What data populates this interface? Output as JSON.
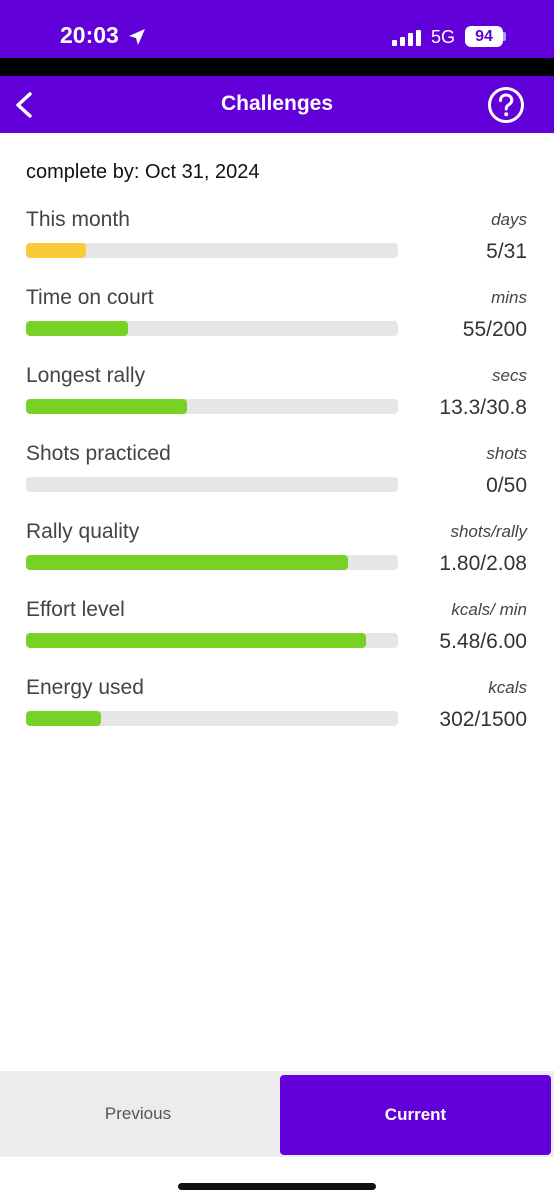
{
  "status_bar": {
    "time": "20:03",
    "network": "5G",
    "battery": "94",
    "icons": [
      "location-arrow-icon",
      "cellular-signal-icon",
      "battery-icon"
    ]
  },
  "header": {
    "title": "Challenges",
    "back_icon": "chevron-left-icon",
    "help_icon": "question-circle-icon"
  },
  "complete_by": "complete by: Oct 31, 2024",
  "challenges": [
    {
      "label": "This month",
      "unit": "days",
      "value": "5/31",
      "progress": 0.161,
      "color": "#fcc93a"
    },
    {
      "label": "Time on court",
      "unit": "mins",
      "value": "55/200",
      "progress": 0.275,
      "color": "#78d226"
    },
    {
      "label": "Longest rally",
      "unit": "secs",
      "value": "13.3/30.8",
      "progress": 0.432,
      "color": "#78d226"
    },
    {
      "label": "Shots practiced",
      "unit": "shots",
      "value": "0/50",
      "progress": 0.0,
      "color": "#78d226"
    },
    {
      "label": "Rally quality",
      "unit": "shots/rally",
      "value": "1.80/2.08",
      "progress": 0.865,
      "color": "#78d226"
    },
    {
      "label": "Effort level",
      "unit": "kcals/ min",
      "value": "5.48/6.00",
      "progress": 0.913,
      "color": "#78d226"
    },
    {
      "label": "Energy used",
      "unit": "kcals",
      "value": "302/1500",
      "progress": 0.201,
      "color": "#78d226"
    }
  ],
  "tabs": {
    "previous": "Previous",
    "current": "Current",
    "selected": "Current"
  },
  "colors": {
    "brand": "#6200d9",
    "track": "#e6e6e6"
  }
}
